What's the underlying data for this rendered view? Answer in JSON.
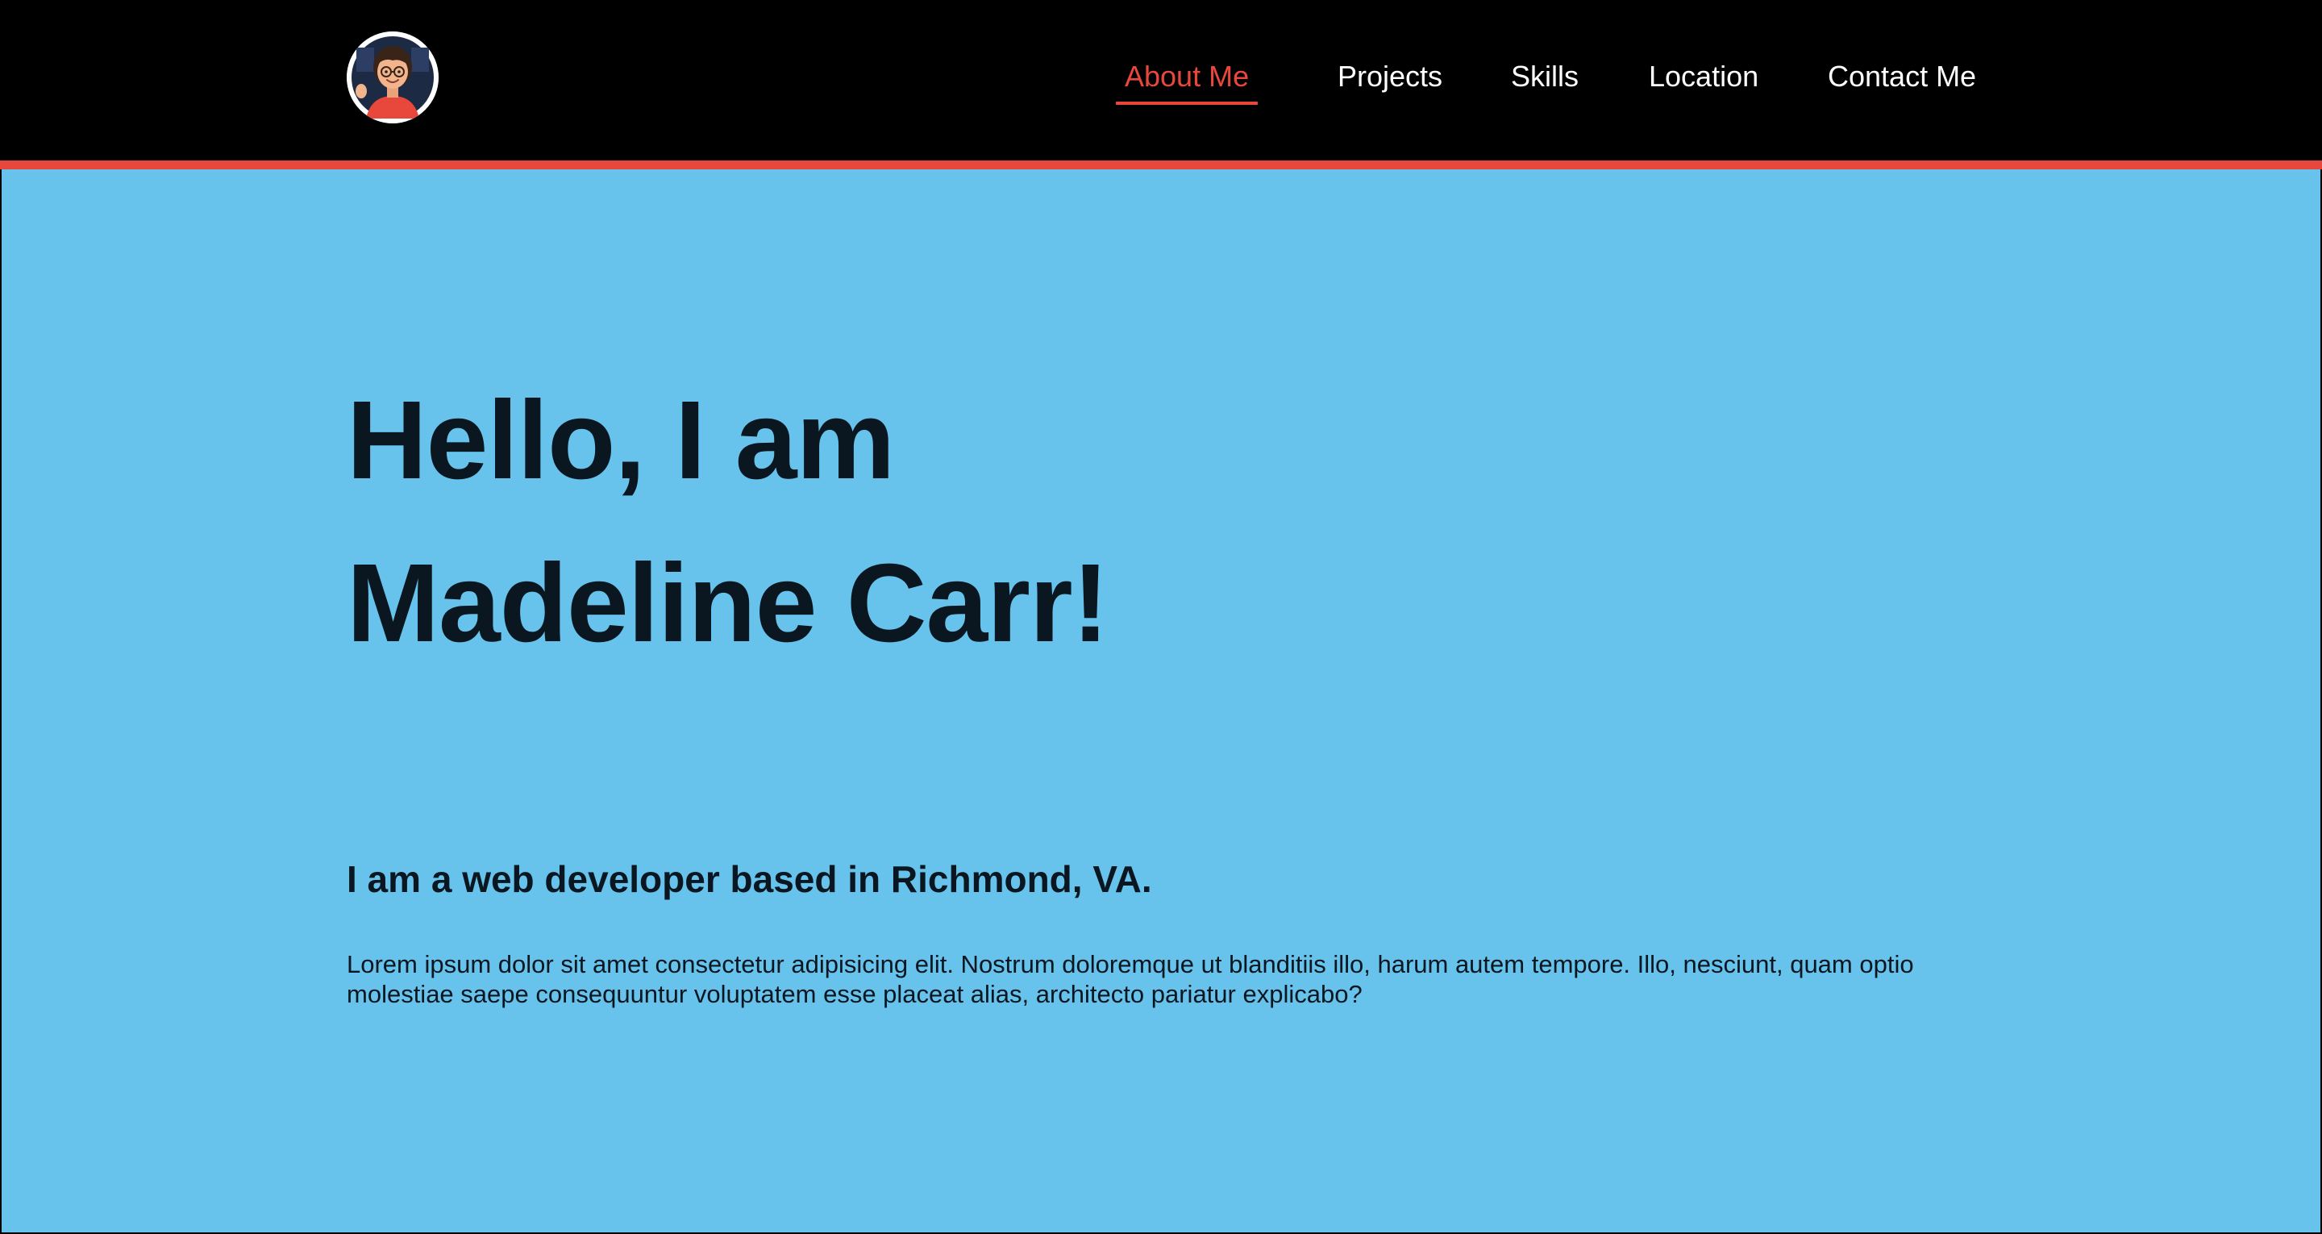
{
  "header": {
    "avatar_icon": "avatar-icon",
    "accent_color": "#e8473c",
    "background_color": "#000000"
  },
  "nav": {
    "items": [
      {
        "label": "About Me",
        "active": true
      },
      {
        "label": "Projects",
        "active": false
      },
      {
        "label": "Skills",
        "active": false
      },
      {
        "label": "Location",
        "active": false
      },
      {
        "label": "Contact Me",
        "active": false
      }
    ]
  },
  "hero": {
    "background_color": "#67c3ec",
    "title_line1": "Hello, I am",
    "title_line2": "Madeline Carr!",
    "subtitle": "I am a web developer based in Richmond, VA.",
    "body": "Lorem ipsum dolor sit amet consectetur adipisicing elit. Nostrum doloremque ut blanditiis illo, harum autem tempore. Illo, nesciunt, quam optio molestiae saepe consequuntur voluptatem esse placeat alias, architecto pariatur explicabo?"
  }
}
